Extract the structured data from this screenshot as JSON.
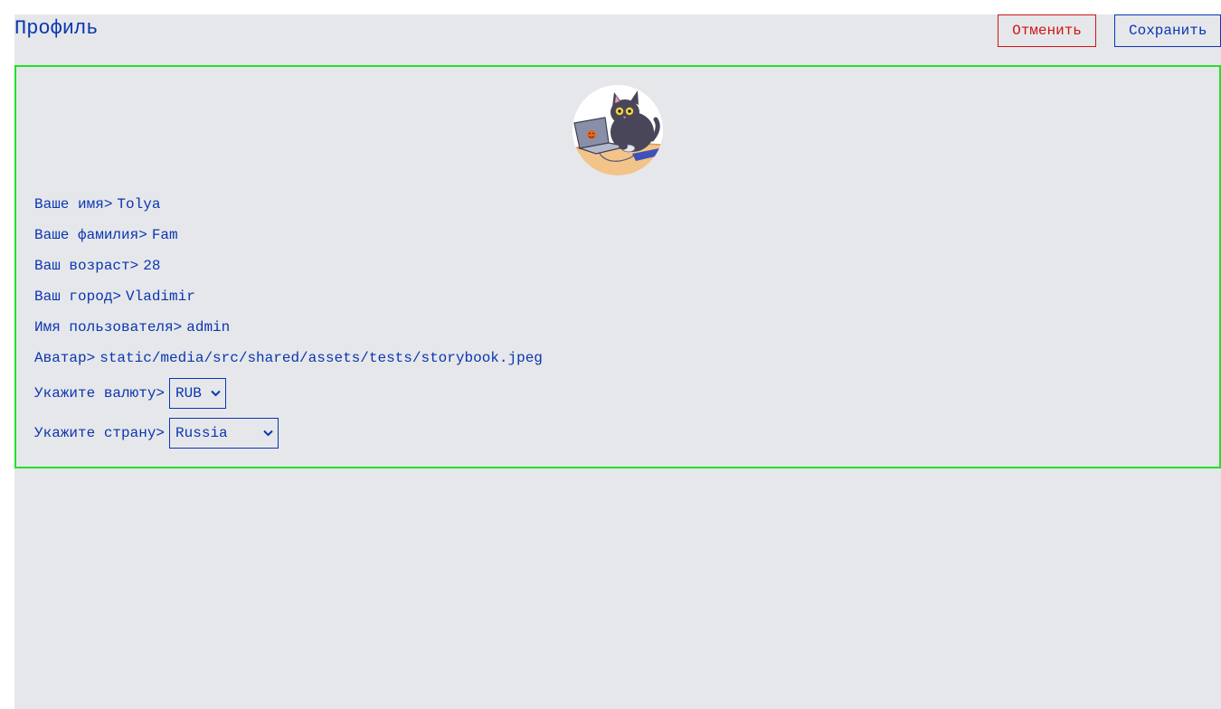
{
  "header": {
    "title": "Профиль",
    "cancel_label": "Отменить",
    "save_label": "Сохранить"
  },
  "profile": {
    "avatar_icon": "cat-with-laptop-avatar",
    "fields": [
      {
        "label": "Ваше имя>",
        "value": "Tolya"
      },
      {
        "label": "Ваше фамилия>",
        "value": "Fam"
      },
      {
        "label": "Ваш возраст>",
        "value": "28"
      },
      {
        "label": "Ваш город>",
        "value": "Vladimir"
      },
      {
        "label": "Имя пользователя>",
        "value": "admin"
      },
      {
        "label": "Аватар>",
        "value": "static/media/src/shared/assets/tests/storybook.jpeg"
      }
    ],
    "currency": {
      "label": "Укажите валюту>",
      "selected": "RUB"
    },
    "country": {
      "label": "Укажите страну>",
      "selected": "Russia"
    }
  },
  "colors": {
    "primary": "#0a36b0",
    "danger": "#d11414",
    "card_border": "#22e02a",
    "background": "#e6e7ea"
  }
}
